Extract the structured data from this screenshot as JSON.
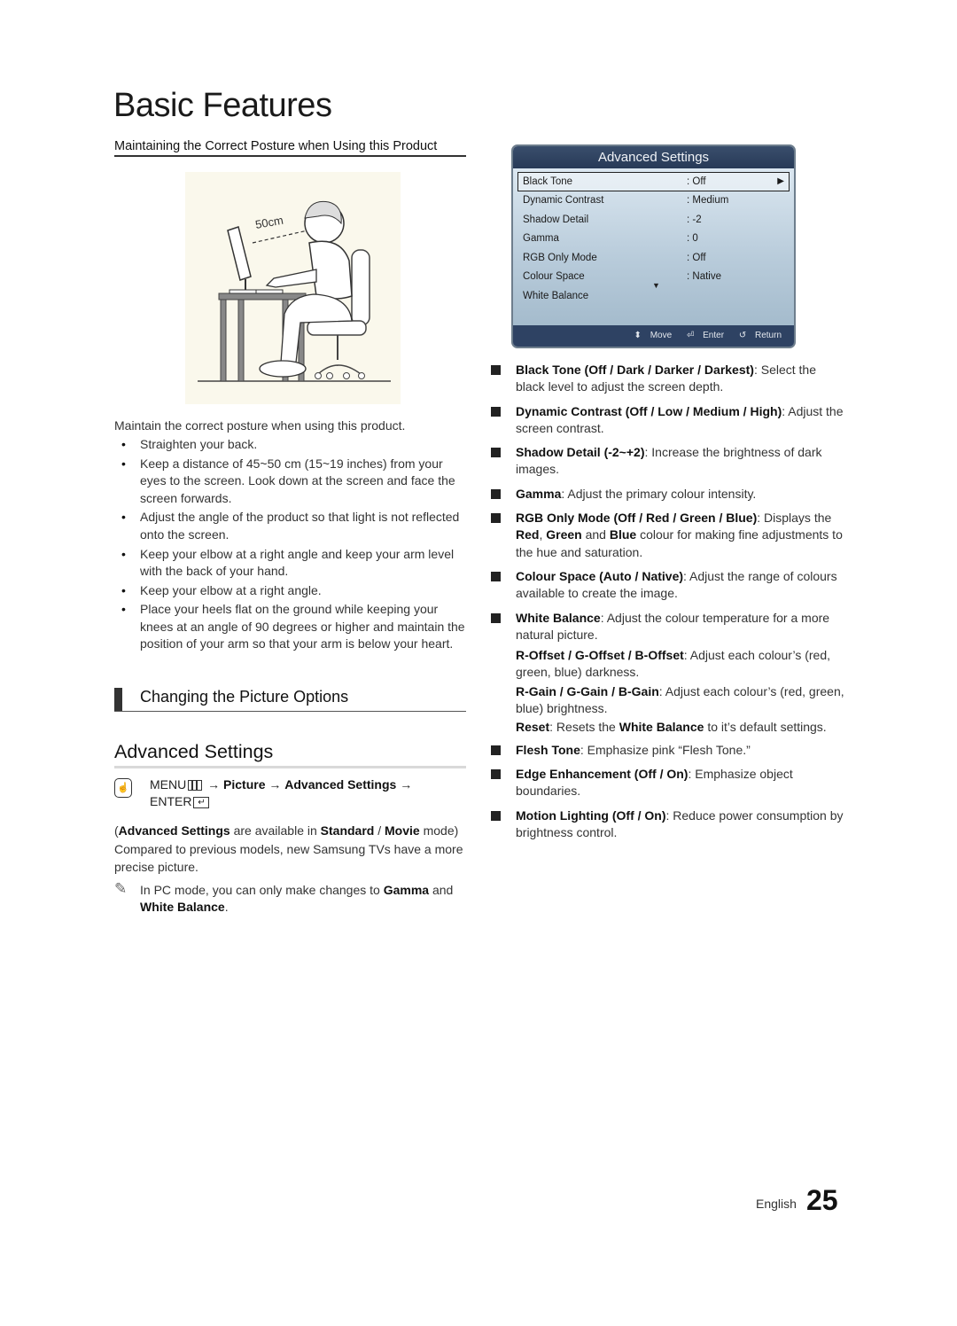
{
  "page": {
    "title": "Basic Features",
    "language": "English",
    "page_number": "25"
  },
  "posture": {
    "heading": "Maintaining the Correct Posture when Using this Product",
    "figure_label": "50cm",
    "intro": "Maintain the correct posture when using this product.",
    "bullets": [
      "Straighten your back.",
      "Keep a distance of 45~50 cm (15~19 inches) from your eyes to the screen. Look down at the screen and face the screen forwards.",
      "Adjust the angle of the product so that light is not reflected onto the screen.",
      "Keep your elbow at a right angle and keep your arm level with the back of your hand.",
      "Keep your elbow at a right angle.",
      "Place your heels flat on the ground while keeping your knees at an angle of 90 degrees or higher and maintain the position of your arm so that your arm is below your heart."
    ]
  },
  "section": {
    "title": "Changing the Picture Options"
  },
  "advanced": {
    "title": "Advanced Settings",
    "menu_path": {
      "menu": "MENU",
      "arrow": "→",
      "picture": "Picture",
      "advanced": "Advanced Settings",
      "enter": "ENTER"
    },
    "availability_prefix": "(",
    "availability_bold1": "Advanced Settings",
    "availability_mid": " are available in ",
    "availability_bold2": "Standard",
    "availability_sep": " / ",
    "availability_bold3": "Movie",
    "availability_suffix": " mode)",
    "compare": "Compared to previous models, new Samsung TVs have a more precise picture.",
    "note_prefix": "In PC mode, you can only make changes to ",
    "note_bold1": "Gamma",
    "note_mid": " and ",
    "note_bold2": "White Balance",
    "note_suffix": "."
  },
  "osd": {
    "title": "Advanced Settings",
    "rows": [
      {
        "label": "Black Tone",
        "value": ": Off",
        "selected": true
      },
      {
        "label": "Dynamic Contrast",
        "value": ": Medium"
      },
      {
        "label": "Shadow Detail",
        "value": ": -2"
      },
      {
        "label": "Gamma",
        "value": ": 0"
      },
      {
        "label": "RGB Only Mode",
        "value": ": Off"
      },
      {
        "label": "Colour Space",
        "value": ": Native"
      },
      {
        "label": "White Balance",
        "value": ""
      }
    ],
    "footer": {
      "move": "Move",
      "enter": "Enter",
      "return": "Return"
    }
  },
  "descriptions": [
    {
      "term": "Black Tone (Off / Dark / Darker / Darkest)",
      "text": ": Select the black level to adjust the screen depth."
    },
    {
      "term": "Dynamic Contrast (Off / Low / Medium / High)",
      "text": ": Adjust the screen contrast."
    },
    {
      "term": "Shadow Detail (-2~+2)",
      "text": ": Increase the brightness of dark images."
    },
    {
      "term": "Gamma",
      "text": ": Adjust the primary colour intensity."
    },
    {
      "term": "RGB Only Mode (Off / Red / Green / Blue)",
      "text": ": Displays the ",
      "b1": "Red",
      "t1": ", ",
      "b2": "Green",
      "t2": " and ",
      "b3": "Blue",
      "t3": " colour for making fine adjustments to the hue and saturation."
    },
    {
      "term": "Colour Space (Auto / Native)",
      "text": ": Adjust the range of colours available to create the image."
    },
    {
      "term": "White Balance",
      "text": ": Adjust the colour temperature for a more natural picture."
    },
    {
      "term": "Flesh Tone",
      "text": ": Emphasize pink “Flesh Tone.”"
    },
    {
      "term": "Edge Enhancement (Off / On)",
      "text": ": Emphasize object boundaries."
    },
    {
      "term": "Motion Lighting (Off / On)",
      "text": ": Reduce power consumption by brightness control."
    }
  ],
  "white_balance_sub": [
    {
      "term": "R-Offset / G-Offset / B-Offset",
      "text": ": Adjust each colour’s (red, green, blue) darkness."
    },
    {
      "term": "R-Gain / G-Gain / B-Gain",
      "text": ": Adjust each colour’s (red, green, blue) brightness."
    },
    {
      "term": "Reset",
      "text": ": Resets the ",
      "b1": "White Balance",
      "t1": " to it’s default settings."
    }
  ]
}
